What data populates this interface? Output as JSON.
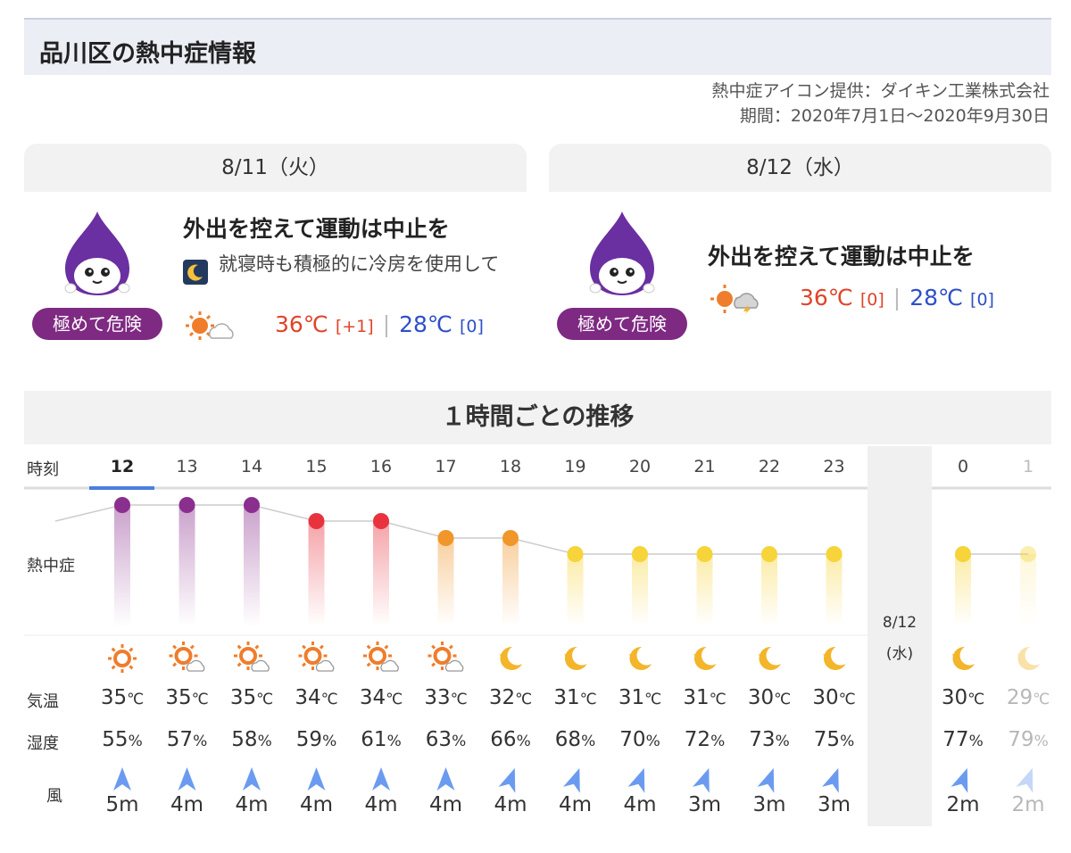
{
  "page_title": "品川区の熱中症情報",
  "credit": {
    "provider": "熱中症アイコン提供：ダイキン工業株式会社",
    "period": "期間：2020年7月1日〜2020年9月30日"
  },
  "days": [
    {
      "date": "8/11（火）",
      "level": "極めて危険",
      "message": "外出を控えて運動は中止を",
      "advice": "就寝時も積極的に冷房を使用して",
      "high": "36℃",
      "high_diff": "[+1]",
      "low": "28℃",
      "low_diff": "[0]",
      "weather_icon": "sun-cloud-icon"
    },
    {
      "date": "8/12（水）",
      "level": "極めて危険",
      "message": "外出を控えて運動は中止を",
      "high": "36℃",
      "high_diff": "[0]",
      "low": "28℃",
      "low_diff": "[0]",
      "weather_icon": "sun-thunder-icon"
    }
  ],
  "hourly": {
    "title": "１時間ごとの推移",
    "labels": {
      "time": "時刻",
      "heat": "熱中症",
      "temp": "気温",
      "humidity": "湿度",
      "wind": "風"
    },
    "divider_date": "8/12",
    "divider_day": "(水)",
    "temp_unit": "℃",
    "humidity_unit": "%",
    "hours": [
      {
        "hour": "12",
        "level": 4,
        "weather": "sun",
        "temp": "35",
        "humidity": "55",
        "wind": "5m",
        "wind_dir": 0
      },
      {
        "hour": "13",
        "level": 4,
        "weather": "sun-cloud",
        "temp": "35",
        "humidity": "57",
        "wind": "4m",
        "wind_dir": 0
      },
      {
        "hour": "14",
        "level": 4,
        "weather": "sun-cloud",
        "temp": "35",
        "humidity": "58",
        "wind": "4m",
        "wind_dir": 0
      },
      {
        "hour": "15",
        "level": 3,
        "weather": "sun-cloud",
        "temp": "34",
        "humidity": "59",
        "wind": "4m",
        "wind_dir": 0
      },
      {
        "hour": "16",
        "level": 3,
        "weather": "sun-cloud",
        "temp": "34",
        "humidity": "61",
        "wind": "4m",
        "wind_dir": 0
      },
      {
        "hour": "17",
        "level": 2,
        "weather": "sun-cloud",
        "temp": "33",
        "humidity": "63",
        "wind": "4m",
        "wind_dir": 0
      },
      {
        "hour": "18",
        "level": 2,
        "weather": "moon",
        "temp": "32",
        "humidity": "66",
        "wind": "4m",
        "wind_dir": 20
      },
      {
        "hour": "19",
        "level": 1,
        "weather": "moon",
        "temp": "31",
        "humidity": "68",
        "wind": "4m",
        "wind_dir": 20
      },
      {
        "hour": "20",
        "level": 1,
        "weather": "moon",
        "temp": "31",
        "humidity": "70",
        "wind": "4m",
        "wind_dir": 20
      },
      {
        "hour": "21",
        "level": 1,
        "weather": "moon",
        "temp": "31",
        "humidity": "72",
        "wind": "3m",
        "wind_dir": 20
      },
      {
        "hour": "22",
        "level": 1,
        "weather": "moon",
        "temp": "30",
        "humidity": "73",
        "wind": "3m",
        "wind_dir": 20
      },
      {
        "hour": "23",
        "level": 1,
        "weather": "moon",
        "temp": "30",
        "humidity": "75",
        "wind": "3m",
        "wind_dir": 20
      },
      {
        "hour": "0",
        "level": 1,
        "weather": "moon",
        "temp": "30",
        "humidity": "77",
        "wind": "2m",
        "wind_dir": 20
      },
      {
        "hour": "1",
        "level": 1,
        "weather": "moon",
        "temp": "29",
        "humidity": "79",
        "wind": "2m",
        "wind_dir": 20
      }
    ]
  },
  "colors": {
    "level4": "#8a2f8e",
    "level3": "#e8333f",
    "level2": "#f0962a",
    "level1": "#f6d43a",
    "sun": "#ef7d2b",
    "moon": "#f3b52a",
    "wind": "#6b9bf0"
  }
}
